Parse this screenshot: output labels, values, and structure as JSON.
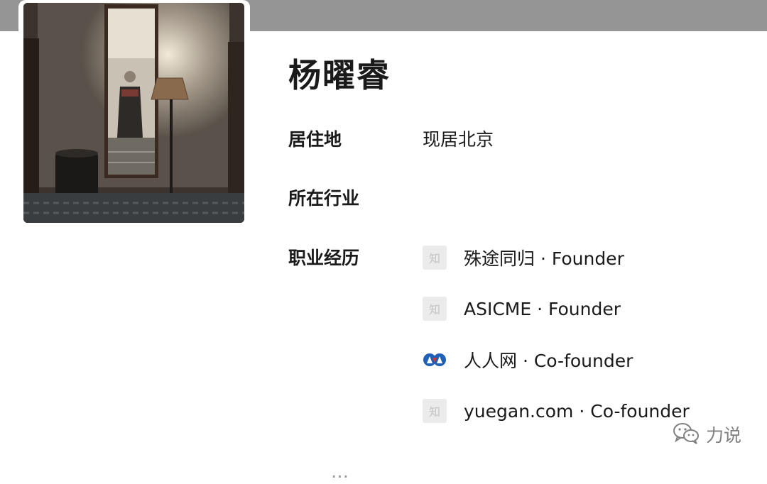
{
  "profile": {
    "name": "杨曜睿",
    "fields": {
      "residence_label": "居住地",
      "residence_value": "现居北京",
      "industry_label": "所在行业",
      "career_label": "职业经历"
    },
    "career": [
      {
        "logo_text": "知",
        "logo_icon": "zhihu-default-logo",
        "text": "殊途同归 · Founder"
      },
      {
        "logo_text": "知",
        "logo_icon": "zhihu-default-logo",
        "text": "ASICME · Founder"
      },
      {
        "logo_text": "",
        "logo_icon": "renren-logo",
        "text": "人人网 · Co-founder"
      },
      {
        "logo_text": "知",
        "logo_icon": "zhihu-default-logo",
        "text": "yuegan.com · Co-founder"
      }
    ],
    "cut_off_text": "…"
  },
  "watermark": {
    "icon": "wechat-icon",
    "text": "力说"
  },
  "colors": {
    "banner": "#959595",
    "text": "#1a1a1a",
    "logo_placeholder": "#ebebeb",
    "renren_blue": "#1f5fb5",
    "renren_red": "#d9342b"
  }
}
